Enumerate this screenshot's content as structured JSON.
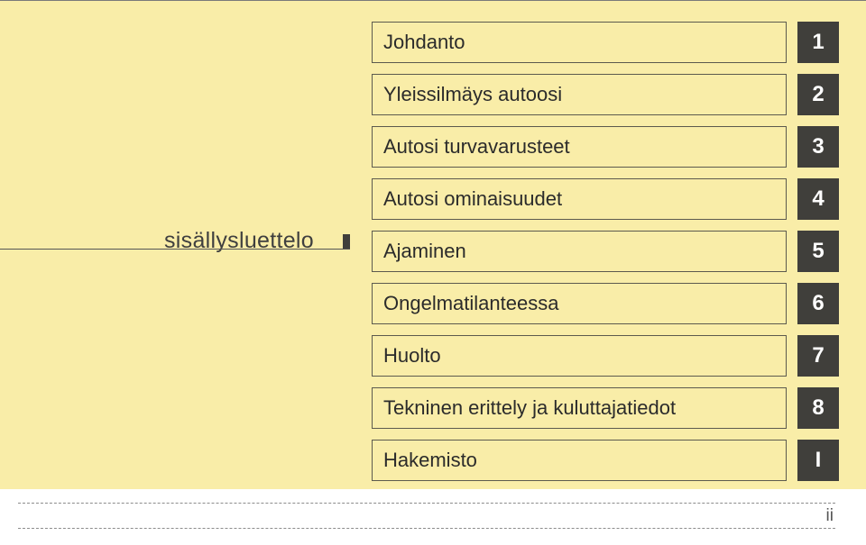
{
  "label": "sisällysluettelo",
  "items": [
    {
      "title": "Johdanto",
      "tab": "1"
    },
    {
      "title": "Yleissilmäys autoosi",
      "tab": "2"
    },
    {
      "title": "Autosi turvavarusteet",
      "tab": "3"
    },
    {
      "title": "Autosi ominaisuudet",
      "tab": "4"
    },
    {
      "title": "Ajaminen",
      "tab": "5"
    },
    {
      "title": "Ongelmatilanteessa",
      "tab": "6"
    },
    {
      "title": "Huolto",
      "tab": "7"
    },
    {
      "title": "Tekninen erittely ja kuluttajatiedot",
      "tab": "8"
    },
    {
      "title": "Hakemisto",
      "tab": "I"
    }
  ],
  "page_number": "ii",
  "colors": {
    "page_bg": "#f9eda8",
    "tab_bg": "#403f3b",
    "tab_fg": "#ffffff",
    "box_border": "#5c5a4e"
  }
}
